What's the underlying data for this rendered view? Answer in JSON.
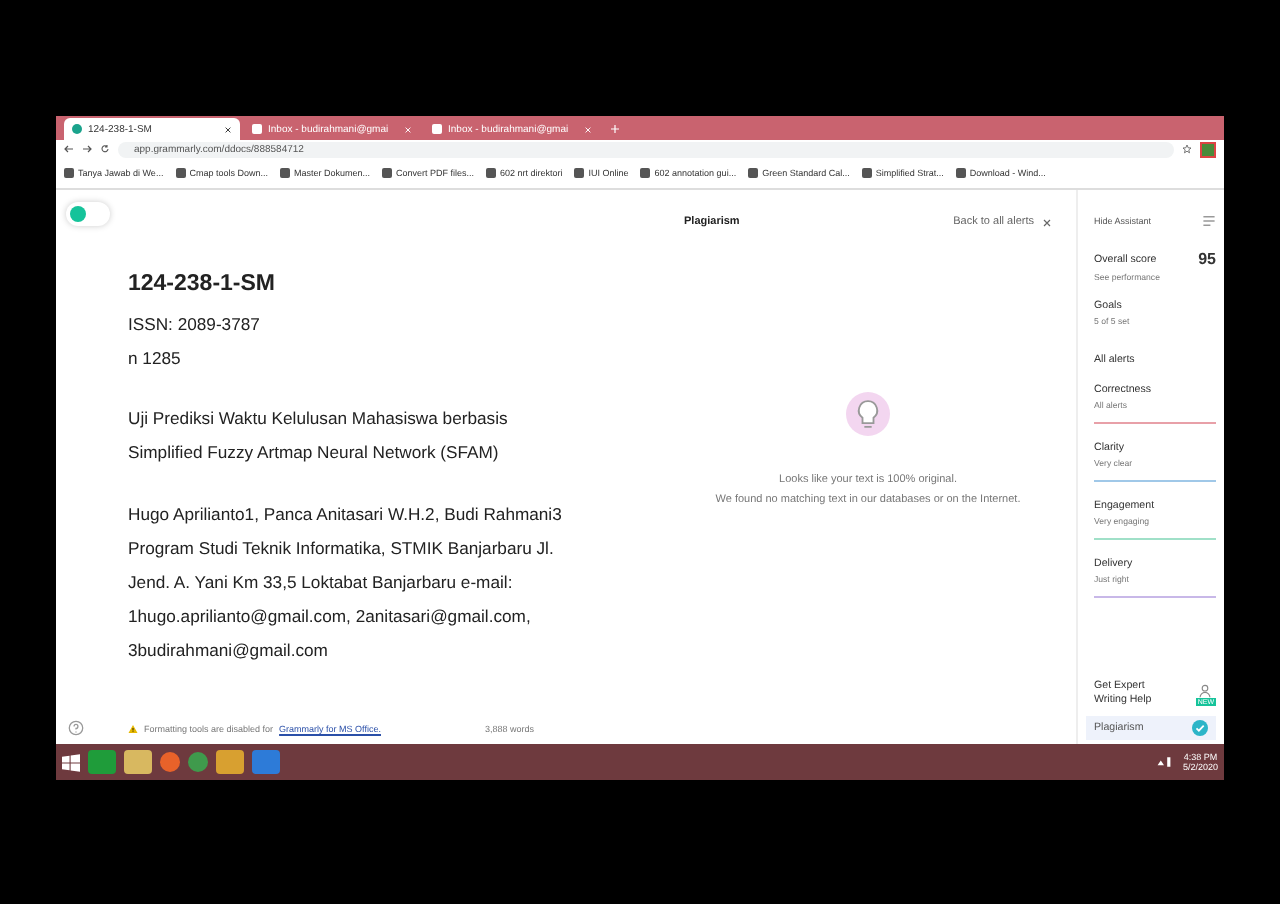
{
  "browser": {
    "tabs": [
      {
        "title": "124-238-1-SM",
        "selected": true
      },
      {
        "title": "Inbox - budirahmani@gmai",
        "selected": false
      },
      {
        "title": "Inbox - budirahmani@gmai",
        "selected": false
      }
    ],
    "address": "app.grammarly.com/ddocs/888584712",
    "bookmarks": [
      "Tanya Jawab di We...",
      "Cmap tools Down...",
      "Master Dokumen...",
      "Convert PDF files...",
      "602 nrt direktori",
      "IUI Online",
      "602 annotation gui...",
      "Green Standard Cal...",
      "Simplified Strat...",
      "Download - Wind..."
    ]
  },
  "document": {
    "title": "124-238-1-SM",
    "lines": [
      "ISSN: 2089-3787",
      "n 1285"
    ],
    "paragraphs": [
      [
        "Uji Prediksi Waktu Kelulusan Mahasiswa berbasis",
        "Simplified Fuzzy Artmap Neural Network (SFAM)"
      ],
      [
        "Hugo Aprilianto1, Panca Anitasari W.H.2, Budi Rahmani3",
        "Program Studi Teknik Informatika, STMIK Banjarbaru Jl.",
        "Jend. A. Yani Km 33,5 Loktabat Banjarbaru e-mail:",
        "1hugo.aprilianto@gmail.com, 2anitasari@gmail.com,",
        "3budirahmani@gmail.com"
      ]
    ]
  },
  "footer": {
    "notice": "Formatting tools are disabled for",
    "link": "Grammarly for MS Office.",
    "word_count": "3,888 words"
  },
  "plagiarism": {
    "title": "Plagiarism",
    "back": "Back to all alerts",
    "messages": [
      "Looks like your text is 100% original.",
      "We found no matching text in our databases or on the Internet."
    ]
  },
  "sidebar": {
    "hide": "Hide Assistant",
    "score_label": "Overall score",
    "score": "95",
    "performance": "See performance",
    "goals": {
      "title": "Goals",
      "value": "5 of 5 set"
    },
    "all_alerts": "All alerts",
    "categories": [
      {
        "name": "Correctness",
        "value": "All alerts",
        "color": "#e8a0a8"
      },
      {
        "name": "Clarity",
        "value": "Very clear",
        "color": "#a0c8e8"
      },
      {
        "name": "Engagement",
        "value": "Very engaging",
        "color": "#a0e0c8"
      },
      {
        "name": "Delivery",
        "value": "Just right",
        "color": "#c8b8e8"
      }
    ],
    "expert": "Get Expert Writing Help",
    "badge": "NEW",
    "plagiarism": {
      "label": "Plagiarism",
      "selected": true
    }
  },
  "taskbar": {
    "time": "4:38 PM",
    "date": "5/2/2020"
  }
}
